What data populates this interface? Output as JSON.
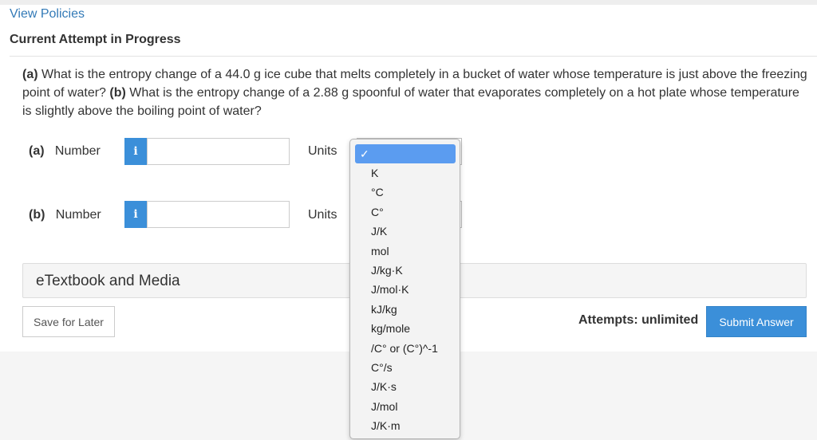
{
  "header": {
    "view_policies": "View Policies",
    "attempt_heading": "Current Attempt in Progress"
  },
  "question": {
    "part_a_marker": "(a)",
    "part_a_text": " What is the entropy change of a 44.0 g ice cube that melts completely in a bucket of water whose temperature is just above the freezing point of water? ",
    "part_b_marker": "(b)",
    "part_b_text": " What is the entropy change of a 2.88 g spoonful of water that evaporates completely on a hot plate whose temperature is slightly above the boiling point of water?"
  },
  "rows": [
    {
      "part": "(a)",
      "number_label": "Number",
      "info": "i",
      "value": "",
      "units_label": "Units"
    },
    {
      "part": "(b)",
      "number_label": "Number",
      "info": "i",
      "value": "",
      "units_label": "Units"
    }
  ],
  "etextbook": {
    "label": "eTextbook and Media"
  },
  "actions": {
    "save_label": "Save for Later",
    "attempts_text": "Attempts: unlimited",
    "submit_label": "Submit Answer"
  },
  "units_dropdown": {
    "selected_mark": "✓",
    "options": [
      "K",
      "°C",
      "C°",
      "J/K",
      "mol",
      "J/kg·K",
      "J/mol·K",
      "kJ/kg",
      "kg/mole",
      "/C° or (C°)^-1",
      "C°/s",
      "J/K·s",
      "J/mol",
      "J/K·m"
    ]
  },
  "colors": {
    "accent": "#3b8fd9",
    "link": "#337ab7",
    "dropdown_highlight": "#5b9cf0"
  }
}
